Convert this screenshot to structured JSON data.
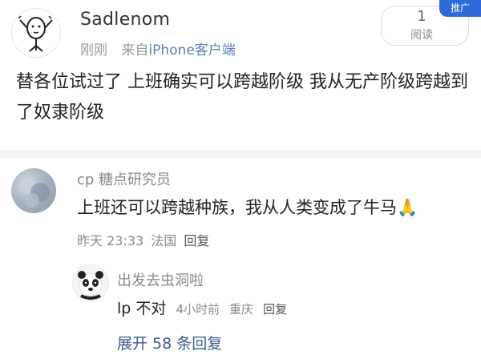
{
  "post": {
    "author": "Sadlenom",
    "time": "刚刚",
    "source_prefix": "来自",
    "source_device": "iPhone",
    "source_suffix": "客户端",
    "read_count": "1",
    "read_label": "阅读",
    "promo_badge": "推广",
    "body": "替各位试过了 上班确实可以跨越阶级 我从无产阶级跨越到了奴隶阶级"
  },
  "comment": {
    "author": "cp 糖点研究员",
    "text": "上班还可以跨越种族，我从人类变成了牛马🙏",
    "time": "昨天 23:33",
    "location": "法国",
    "reply_label": "回复"
  },
  "reply": {
    "author": "出发去虫洞啦",
    "text": "lp 不对",
    "time": "4小时前",
    "location": "重庆",
    "reply_label": "回复",
    "expand_label": "展开 58 条回复"
  },
  "icons": {
    "main_avatar": "doodle-figure-icon",
    "comment_avatar": "blurred-photo-avatar",
    "reply_avatar": "panda-avatar"
  },
  "colors": {
    "link_blue": "#3b5b8f",
    "promo_blue": "#2f6bd8",
    "meta_gray": "#8a8a8a"
  }
}
